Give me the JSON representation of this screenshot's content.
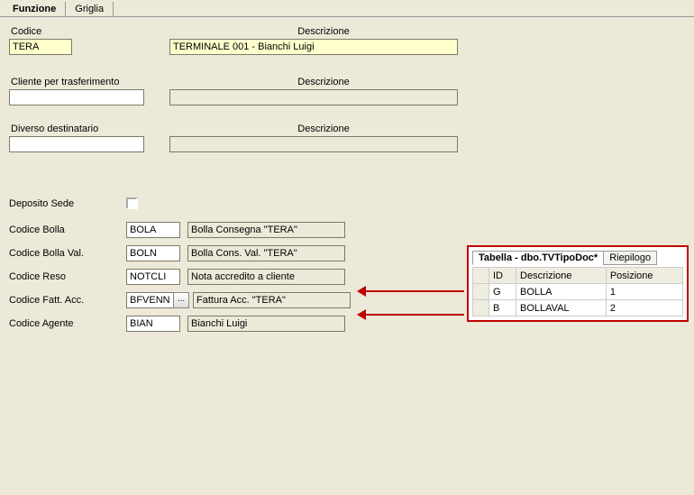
{
  "tabs": {
    "funzione": "Funzione",
    "griglia": "Griglia"
  },
  "fields": {
    "codice_label": "Codice",
    "codice_value": "TERA",
    "descrizione_label": "Descrizione",
    "descrizione_value": "TERMINALE 001 - Bianchi Luigi",
    "cliente_label": "Cliente per trasferimento",
    "cliente_value": "",
    "cliente_desc_label": "Descrizione",
    "cliente_desc_value": "",
    "diverso_label": "Diverso destinatario",
    "diverso_value": "",
    "diverso_desc_label": "Descrizione",
    "diverso_desc_value": "",
    "deposito_label": "Deposito Sede"
  },
  "rows": {
    "codice_bolla_label": "Codice Bolla",
    "codice_bolla_val": "BOLA",
    "codice_bolla_desc": "Bolla Consegna \"TERA\"",
    "codice_bolla_val_label": "Codice Bolla Val.",
    "codice_bolla_val_val": "BOLN",
    "codice_bolla_val_desc": "Bolla Cons. Val. \"TERA\"",
    "codice_reso_label": "Codice Reso",
    "codice_reso_val": "NOTCLI",
    "codice_reso_desc": "Nota accredito a cliente",
    "codice_fatt_label": "Codice Fatt. Acc.",
    "codice_fatt_val": "BFVENN",
    "codice_fatt_desc": "Fattura Acc. \"TERA\"",
    "dots": "...",
    "codice_agente_label": "Codice Agente",
    "codice_agente_val": "BIAN",
    "codice_agente_desc": "Bianchi Luigi"
  },
  "panel": {
    "tab1": "Tabella - dbo.TVTipoDoc*",
    "tab2": "Riepilogo",
    "headers": {
      "id": "ID",
      "descr": "Descrizione",
      "pos": "Posizione"
    },
    "data": [
      {
        "id": "G",
        "descr": "BOLLA",
        "pos": "1"
      },
      {
        "id": "B",
        "descr": "BOLLAVAL",
        "pos": "2"
      }
    ]
  }
}
